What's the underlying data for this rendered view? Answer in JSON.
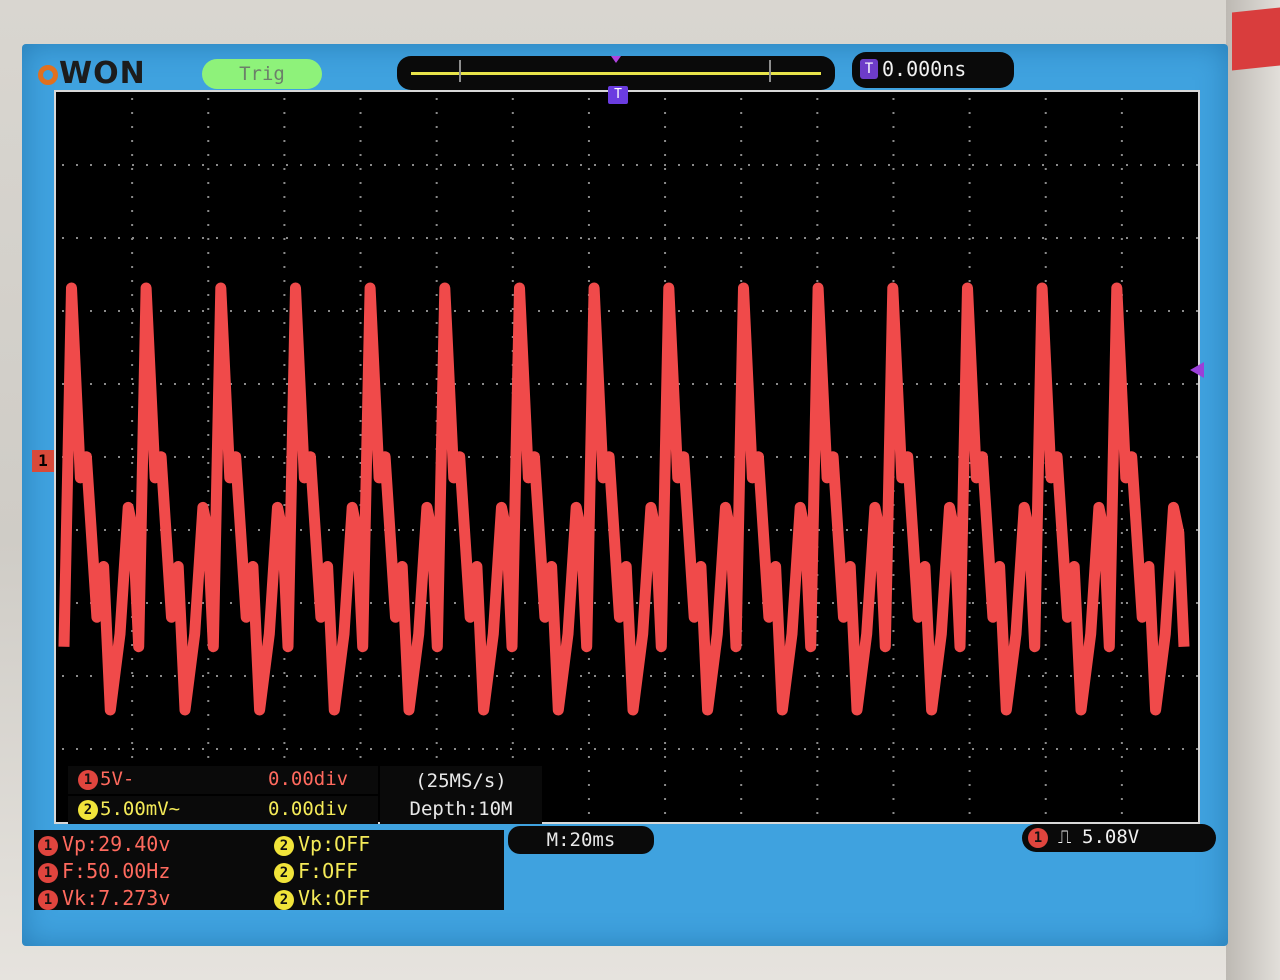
{
  "header": {
    "logo_text": "WON",
    "trigger_status": "Trig",
    "trigger_time": "0.000ns",
    "trigger_time_icon": "T"
  },
  "graticule": {
    "channel1_marker": "1",
    "trigger_position_marker": "T"
  },
  "channels": {
    "ch1": {
      "badge": "1",
      "scale": "5V-",
      "offset": "0.00div"
    },
    "ch2": {
      "badge": "2",
      "scale": "5.00mV~",
      "offset": "0.00div"
    }
  },
  "acquisition": {
    "sample_rate": "(25MS/s)",
    "depth": "Depth:10M"
  },
  "measurements": {
    "ch1": [
      {
        "badge": "1",
        "text": "Vp:29.40v"
      },
      {
        "badge": "1",
        "text": "F:50.00Hz"
      },
      {
        "badge": "1",
        "text": "Vk:7.273v"
      }
    ],
    "ch2": [
      {
        "badge": "2",
        "text": "Vp:OFF"
      },
      {
        "badge": "2",
        "text": "F:OFF"
      },
      {
        "badge": "2",
        "text": "Vk:OFF"
      }
    ]
  },
  "timebase": {
    "label": "M:20ms"
  },
  "trigger": {
    "badge": "1",
    "edge_symbol": "⎍",
    "level": "5.08V"
  },
  "colors": {
    "screen_bg": "#3fa2df",
    "ch1_trace": "#f04a4a",
    "ch2": "#f1e43a",
    "trigger_marker": "#9b3fd8",
    "status_green": "#8ef27a"
  }
}
